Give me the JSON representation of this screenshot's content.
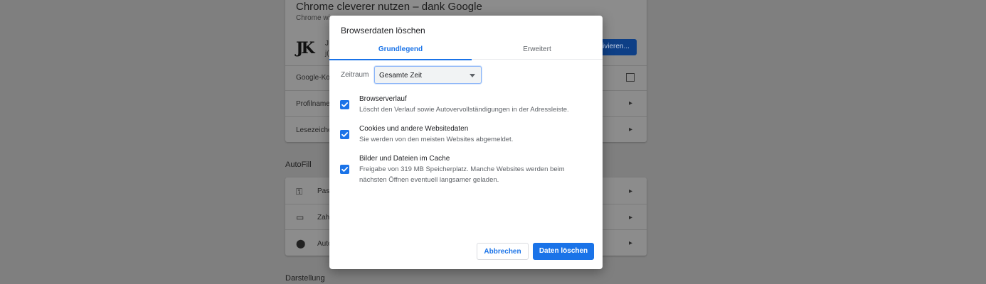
{
  "background": {
    "heading": "Chrome cleverer nutzen – dank Google",
    "subheading": "Chrome wi",
    "logo_text": "JK",
    "account_line1": "J",
    "account_line2": "j(",
    "sync_button": "ivieren...",
    "rows": [
      "Google-Kon",
      "Profilname",
      "Lesezeiche"
    ],
    "autofill_section": "AutoFill",
    "autofill_rows": [
      "Pass",
      "Zahl",
      "Auto"
    ],
    "appearance_section": "Darstellung"
  },
  "dialog": {
    "title": "Browserdaten löschen",
    "tabs": [
      {
        "label": "Grundlegend",
        "active": true
      },
      {
        "label": "Erweitert",
        "active": false
      }
    ],
    "range_label": "Zeitraum",
    "range_value": "Gesamte Zeit",
    "options": [
      {
        "title": "Browserverlauf",
        "description": "Löscht den Verlauf sowie Autovervollständigungen in der Adressleiste.",
        "checked": true
      },
      {
        "title": "Cookies und andere Websitedaten",
        "description": "Sie werden von den meisten Websites abgemeldet.",
        "checked": true
      },
      {
        "title": "Bilder und Dateien im Cache",
        "description": "Freigabe von 319 MB Speicherplatz. Manche Websites werden beim nächsten Öffnen eventuell langsamer geladen.",
        "checked": true
      }
    ],
    "cancel_label": "Abbrechen",
    "confirm_label": "Daten löschen"
  },
  "colors": {
    "accent": "#1a73e8",
    "overlay": "#7f7f7f"
  }
}
